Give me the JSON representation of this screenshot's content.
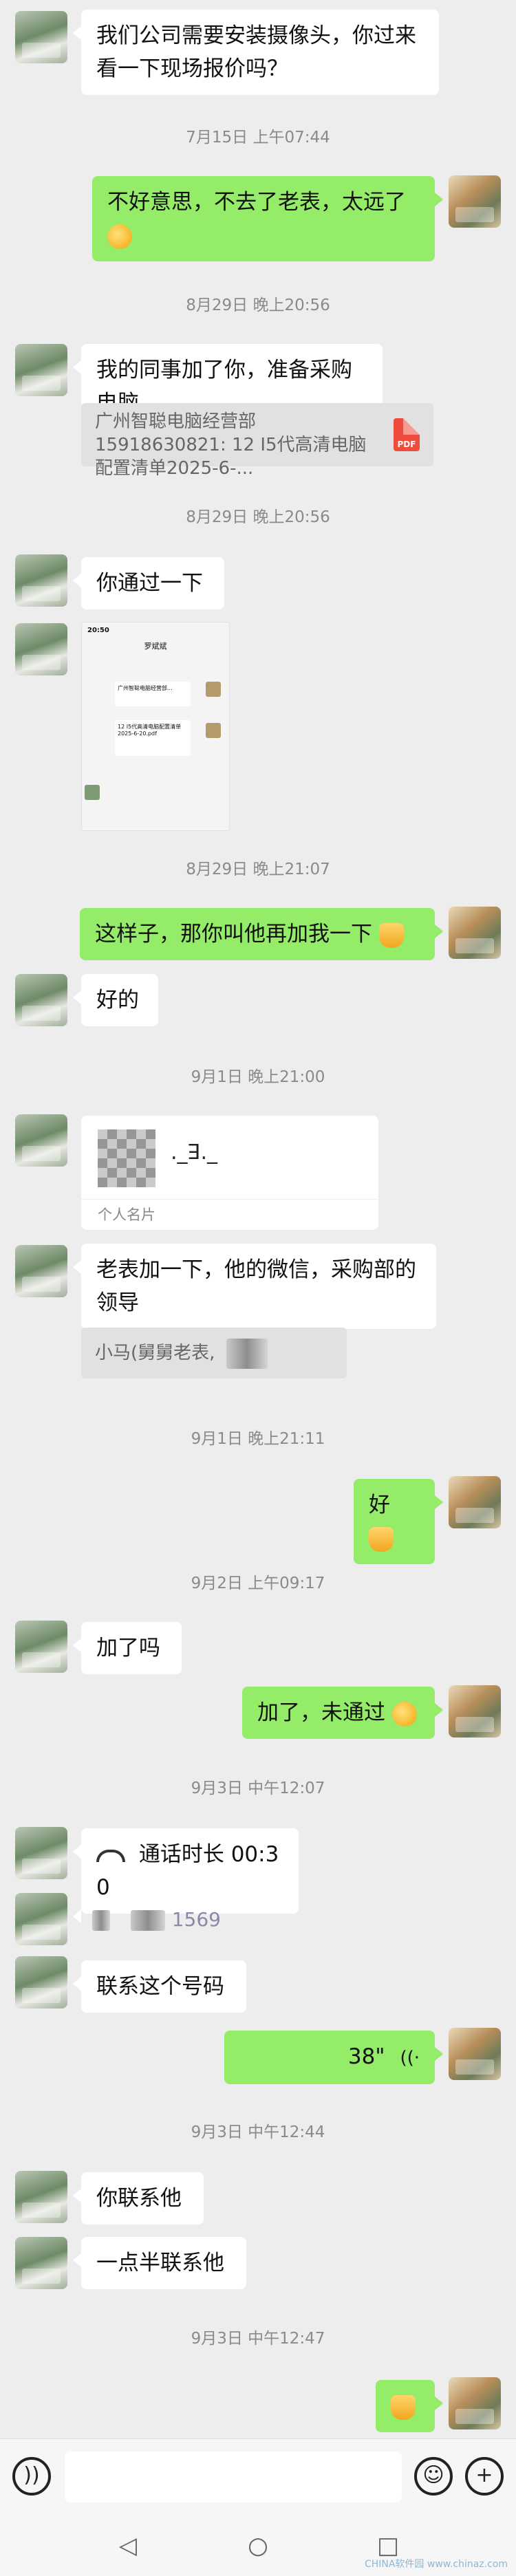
{
  "messages": {
    "m1": "我们公司需要安装摄像头，你过来看一下现场报价吗？",
    "t1": "7月15日 上午07:44",
    "m2": "不好意思，不去了老表，太远了",
    "t2": "8月29日 晚上20:56",
    "m3": "我的同事加了你，准备采购电脑",
    "m3_quote": "广州智聪电脑经营部15918630821: 12 I5代高清电脑配置清单2025-6-...",
    "m3_quote_icon": "PDF",
    "t3": "8月29日 晚上20:56",
    "m4": "你通过一下",
    "shot_time": "20:50",
    "shot_name": "罗斌斌",
    "shot_msg1": "广州智聪电脑经营部...",
    "shot_msg2": "12 I5代高清电脑配置清单2025-6-20.pdf",
    "t4": "8月29日 晚上21:07",
    "m5": "这样子，那你叫他再加我一下",
    "m6": "好的",
    "t5": "9月1日 晚上21:00",
    "card_name": "._ꓱ._",
    "card_label": "个人名片",
    "m7": "老表加一下，他的微信，采购部的领导",
    "m7_quote": "小马(舅舅老表,",
    "t6": "9月1日 晚上21:11",
    "m8": "好",
    "t7": "9月2日 上午09:17",
    "m9": "加了吗",
    "m10": "加了，未通过",
    "t8": "9月3日 中午12:07",
    "m11": "通话时长 00:30",
    "m12": "1569",
    "m13": "联系这个号码",
    "m14": "38\"",
    "t9": "9月3日 中午12:44",
    "m15": "你联系他",
    "m16": "一点半联系他",
    "t10": "9月3日 中午12:47"
  },
  "input_bar": {
    "voice_symbol": "))",
    "emoji_symbol": "☺",
    "plus_symbol": "+"
  },
  "nav": {
    "back": "◁",
    "home": "○",
    "recent": "□"
  },
  "watermark": "CHINA软件园 www.chinaz.com"
}
